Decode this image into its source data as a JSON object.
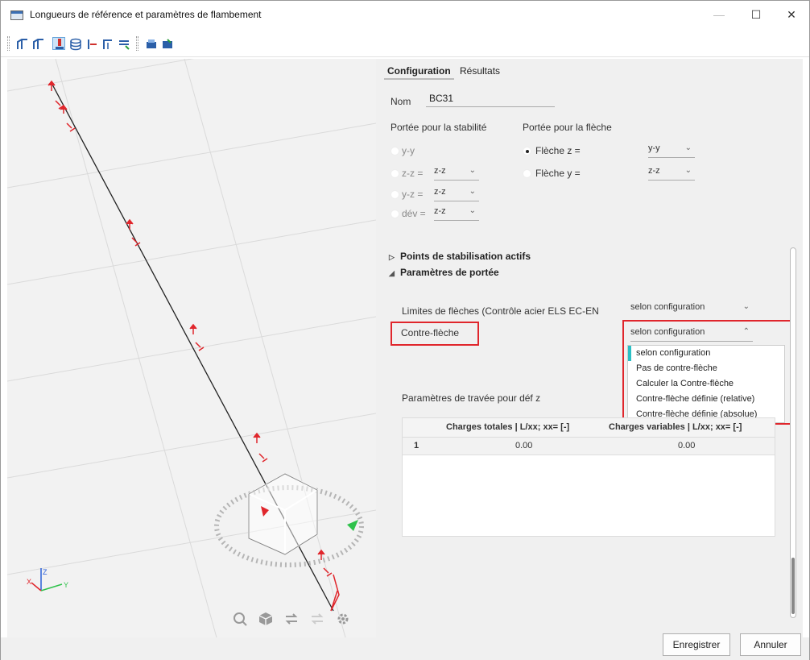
{
  "window": {
    "title": "Longueurs de référence et paramètres de flambement",
    "minimize": "—",
    "maximize": "☐",
    "close": "✕"
  },
  "tabs": [
    {
      "label": "Configuration",
      "active": true
    },
    {
      "label": "Résultats",
      "active": false
    }
  ],
  "name_field": {
    "label": "Nom",
    "value": "BC31"
  },
  "stability": {
    "header": "Portée pour la stabilité",
    "options": [
      {
        "label": "y-y",
        "selected": false,
        "combo": ""
      },
      {
        "label": "z-z =",
        "selected": false,
        "combo": "z-z"
      },
      {
        "label": "y-z =",
        "selected": false,
        "combo": "z-z"
      },
      {
        "label": "dév =",
        "selected": false,
        "combo": "z-z"
      }
    ]
  },
  "deflection": {
    "header": "Portée pour la flèche",
    "options": [
      {
        "label": "Flèche z =",
        "selected": true,
        "combo": "y-y"
      },
      {
        "label": "Flèche y =",
        "selected": false,
        "combo": "z-z"
      }
    ]
  },
  "sections": {
    "active_points": "Points de stabilisation actifs",
    "span_params": "Paramètres de portée"
  },
  "limits": {
    "label": "Limites de flèches (Contrôle acier ELS EC-EN",
    "value": "selon configuration"
  },
  "camber": {
    "label": "Contre-flèche",
    "value": "selon configuration"
  },
  "camber_options": [
    "selon configuration",
    "Pas de contre-flèche",
    "Calculer la Contre-flèche",
    "Contre-flèche définie (relative)",
    "Contre-flèche définie (absolue)"
  ],
  "span_table": {
    "title": "Paramètres de travée pour déf z",
    "headers": [
      "Charges totales | L/xx; xx= [-]",
      "Charges variables | L/xx; xx= [-]"
    ],
    "rows": [
      {
        "index": "1",
        "total": "0.00",
        "variable": "0.00"
      }
    ]
  },
  "buttons": {
    "save": "Enregistrer",
    "cancel": "Annuler"
  },
  "colors": {
    "highlight": "#e0262c",
    "selection": "#2bbfc4",
    "member": "#222222",
    "support": "#e0262c"
  },
  "axis_labels": {
    "z": "Z",
    "y": "Y",
    "x": "X"
  }
}
